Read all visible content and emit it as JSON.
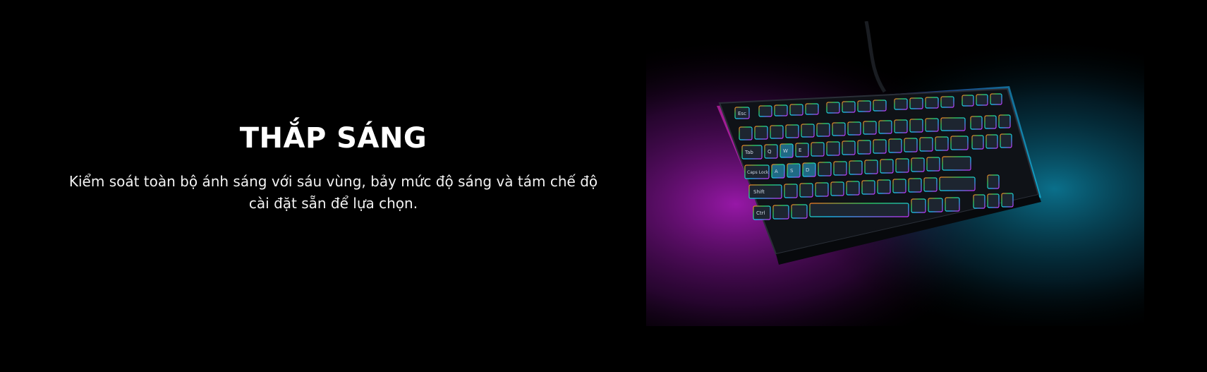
{
  "section": {
    "title": "THẮP SÁNG",
    "description": "Kiểm soát toàn bộ ánh sáng với sáu vùng, bảy mức độ sáng và tám chế độ cài đặt sẵn để lựa chọn."
  },
  "image": {
    "subject": "rgb-tenkeyless-keyboard",
    "key_labels": {
      "esc": "Esc",
      "tab": "Tab",
      "caps": "Caps Lock",
      "shift": "Shift",
      "ctrl": "Ctrl",
      "q": "Q",
      "w": "W",
      "e": "E",
      "a": "A",
      "s": "S",
      "d": "D"
    },
    "colors": {
      "glow_magenta": "#d21ecf",
      "glow_cyan": "#13b8d8",
      "keycap": "#1d2530",
      "case": "#0f1217"
    }
  }
}
